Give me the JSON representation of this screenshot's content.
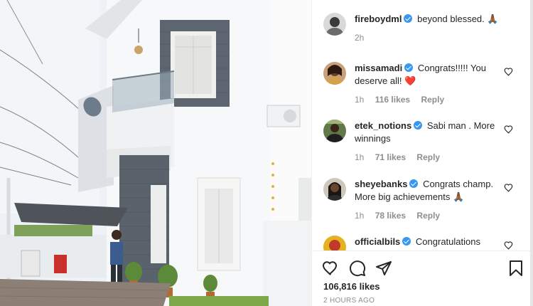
{
  "post": {
    "caption": {
      "username": "fireboydml",
      "text": "beyond blessed. 🙏🏾",
      "time": "2h"
    }
  },
  "comments": [
    {
      "username": "missamadi",
      "text": "Congrats!!!!! You deserve all! ❤️",
      "time": "1h",
      "likes": "116 likes",
      "reply": "Reply"
    },
    {
      "username": "etek_notions",
      "text": "Sabi man . More winnings",
      "time": "1h",
      "likes": "71 likes",
      "reply": "Reply"
    },
    {
      "username": "sheyebanks",
      "text": "Congrats champ. More big achievements 🙏🏾",
      "time": "1h",
      "likes": "78 likes",
      "reply": "Reply"
    },
    {
      "username": "officialbils",
      "text": "Congratulations"
    }
  ],
  "actions": {
    "likes": "106,816 likes",
    "posted": "2 HOURS AGO"
  },
  "icons": [
    "heart-icon",
    "comment-icon",
    "share-icon",
    "bookmark-icon"
  ],
  "colors": {
    "verified": "#3897f0",
    "text": "#262626",
    "muted": "#8e8e8e"
  }
}
